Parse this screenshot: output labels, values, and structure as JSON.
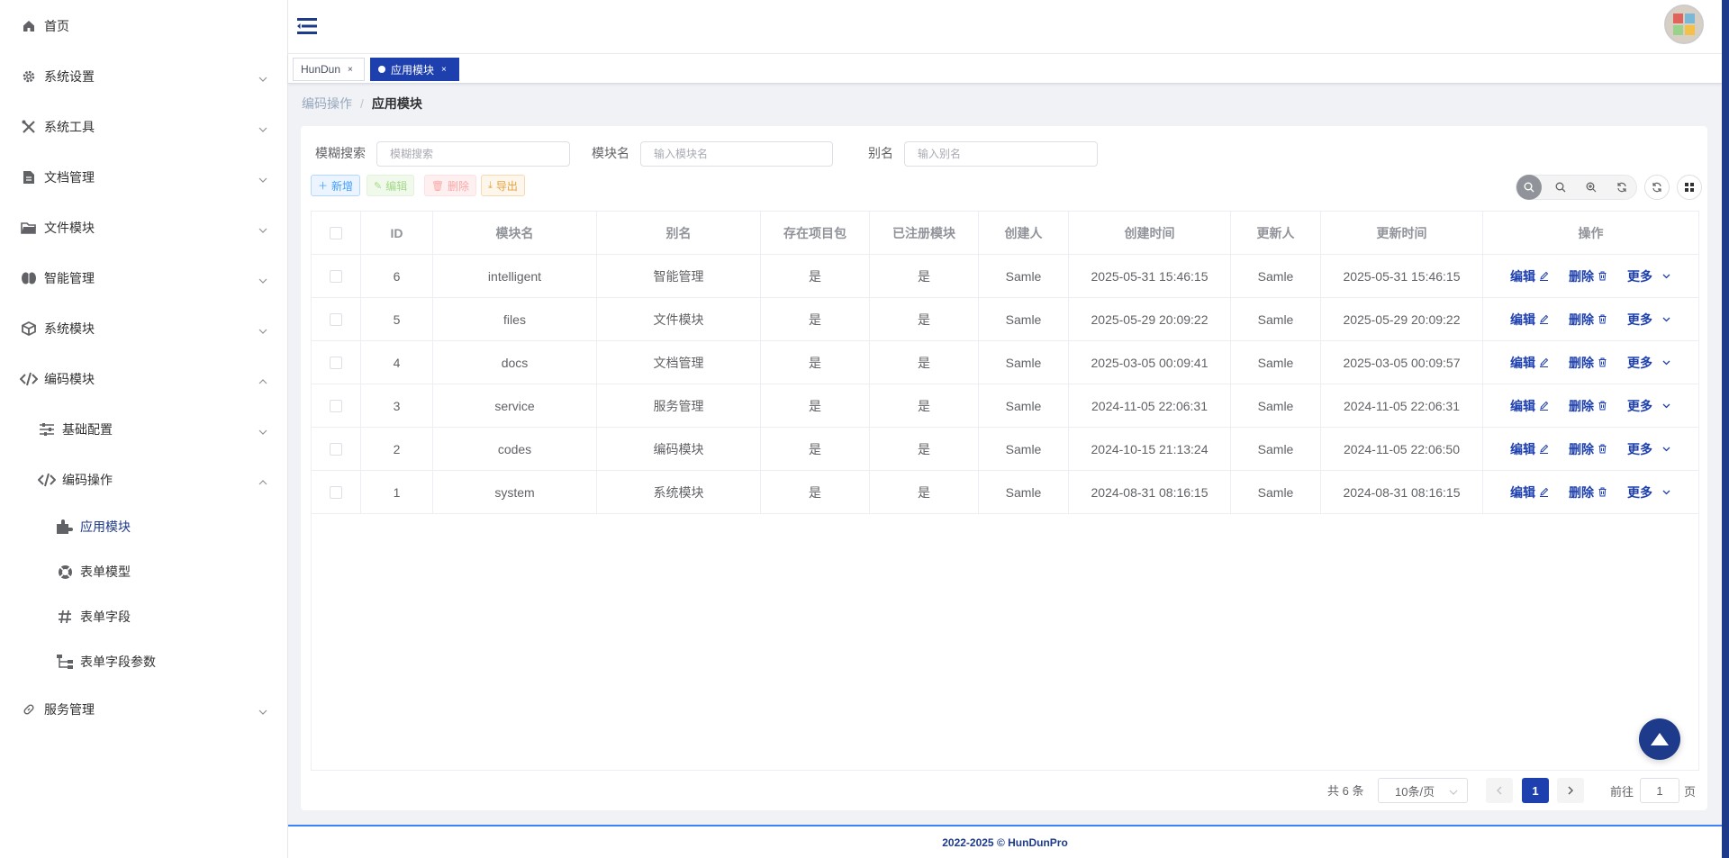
{
  "sidebar": {
    "items": [
      {
        "label": "首页",
        "icon": "home-icon"
      },
      {
        "label": "系统设置",
        "icon": "gear-icon"
      },
      {
        "label": "系统工具",
        "icon": "tools-icon"
      },
      {
        "label": "文档管理",
        "icon": "document-icon"
      },
      {
        "label": "文件模块",
        "icon": "folder-icon"
      },
      {
        "label": "智能管理",
        "icon": "brain-icon"
      },
      {
        "label": "系统模块",
        "icon": "cube-icon"
      },
      {
        "label": "编码模块",
        "icon": "code-icon"
      },
      {
        "label": "基础配置",
        "icon": "sliders-icon"
      },
      {
        "label": "编码操作",
        "icon": "code-icon"
      },
      {
        "label": "应用模块",
        "icon": "puzzle-icon"
      },
      {
        "label": "表单模型",
        "icon": "lifebuoy-icon"
      },
      {
        "label": "表单字段",
        "icon": "hash-icon"
      },
      {
        "label": "表单字段参数",
        "icon": "tree-icon"
      },
      {
        "label": "服务管理",
        "icon": "link-icon"
      }
    ]
  },
  "tags": [
    {
      "label": "HunDun",
      "close": "×"
    },
    {
      "label": "应用模块",
      "close": "×"
    }
  ],
  "breadcrumb": {
    "parent": "编码操作",
    "sep": "/",
    "current": "应用模块"
  },
  "search": {
    "fuzzy_label": "模糊搜索",
    "fuzzy_placeholder": "模糊搜索",
    "name_label": "模块名",
    "name_placeholder": "输入模块名",
    "alias_label": "别名",
    "alias_placeholder": "输入别名"
  },
  "toolbar": {
    "add": "新增",
    "edit": "编辑",
    "delete": "删除",
    "export": "导出"
  },
  "table": {
    "headers": [
      "ID",
      "模块名",
      "别名",
      "存在项目包",
      "已注册模块",
      "创建人",
      "创建时间",
      "更新人",
      "更新时间",
      "操作"
    ],
    "rows": [
      {
        "id": "6",
        "name": "intelligent",
        "alias": "智能管理",
        "pkg": "是",
        "reg": "是",
        "creator": "Samle",
        "created": "2025-05-31 15:46:15",
        "updater": "Samle",
        "updated": "2025-05-31 15:46:15"
      },
      {
        "id": "5",
        "name": "files",
        "alias": "文件模块",
        "pkg": "是",
        "reg": "是",
        "creator": "Samle",
        "created": "2025-05-29 20:09:22",
        "updater": "Samle",
        "updated": "2025-05-29 20:09:22"
      },
      {
        "id": "4",
        "name": "docs",
        "alias": "文档管理",
        "pkg": "是",
        "reg": "是",
        "creator": "Samle",
        "created": "2025-03-05 00:09:41",
        "updater": "Samle",
        "updated": "2025-03-05 00:09:57"
      },
      {
        "id": "3",
        "name": "service",
        "alias": "服务管理",
        "pkg": "是",
        "reg": "是",
        "creator": "Samle",
        "created": "2024-11-05 22:06:31",
        "updater": "Samle",
        "updated": "2024-11-05 22:06:31"
      },
      {
        "id": "2",
        "name": "codes",
        "alias": "编码模块",
        "pkg": "是",
        "reg": "是",
        "creator": "Samle",
        "created": "2024-10-15 21:13:24",
        "updater": "Samle",
        "updated": "2024-11-05 22:06:50"
      },
      {
        "id": "1",
        "name": "system",
        "alias": "系统模块",
        "pkg": "是",
        "reg": "是",
        "creator": "Samle",
        "created": "2024-08-31 08:16:15",
        "updater": "Samle",
        "updated": "2024-08-31 08:16:15"
      }
    ],
    "actions": {
      "edit": "编辑",
      "delete": "删除",
      "more": "更多"
    }
  },
  "pagination": {
    "total": "共 6 条",
    "page_size": "10条/页",
    "current": "1",
    "goto_label": "前往",
    "goto_value": "1",
    "page_suffix": "页"
  },
  "footer": {
    "text": "2022-2025 © HunDunPro"
  },
  "colors": {
    "accent": "#1e40af",
    "dark_accent": "#1e3a8a"
  }
}
